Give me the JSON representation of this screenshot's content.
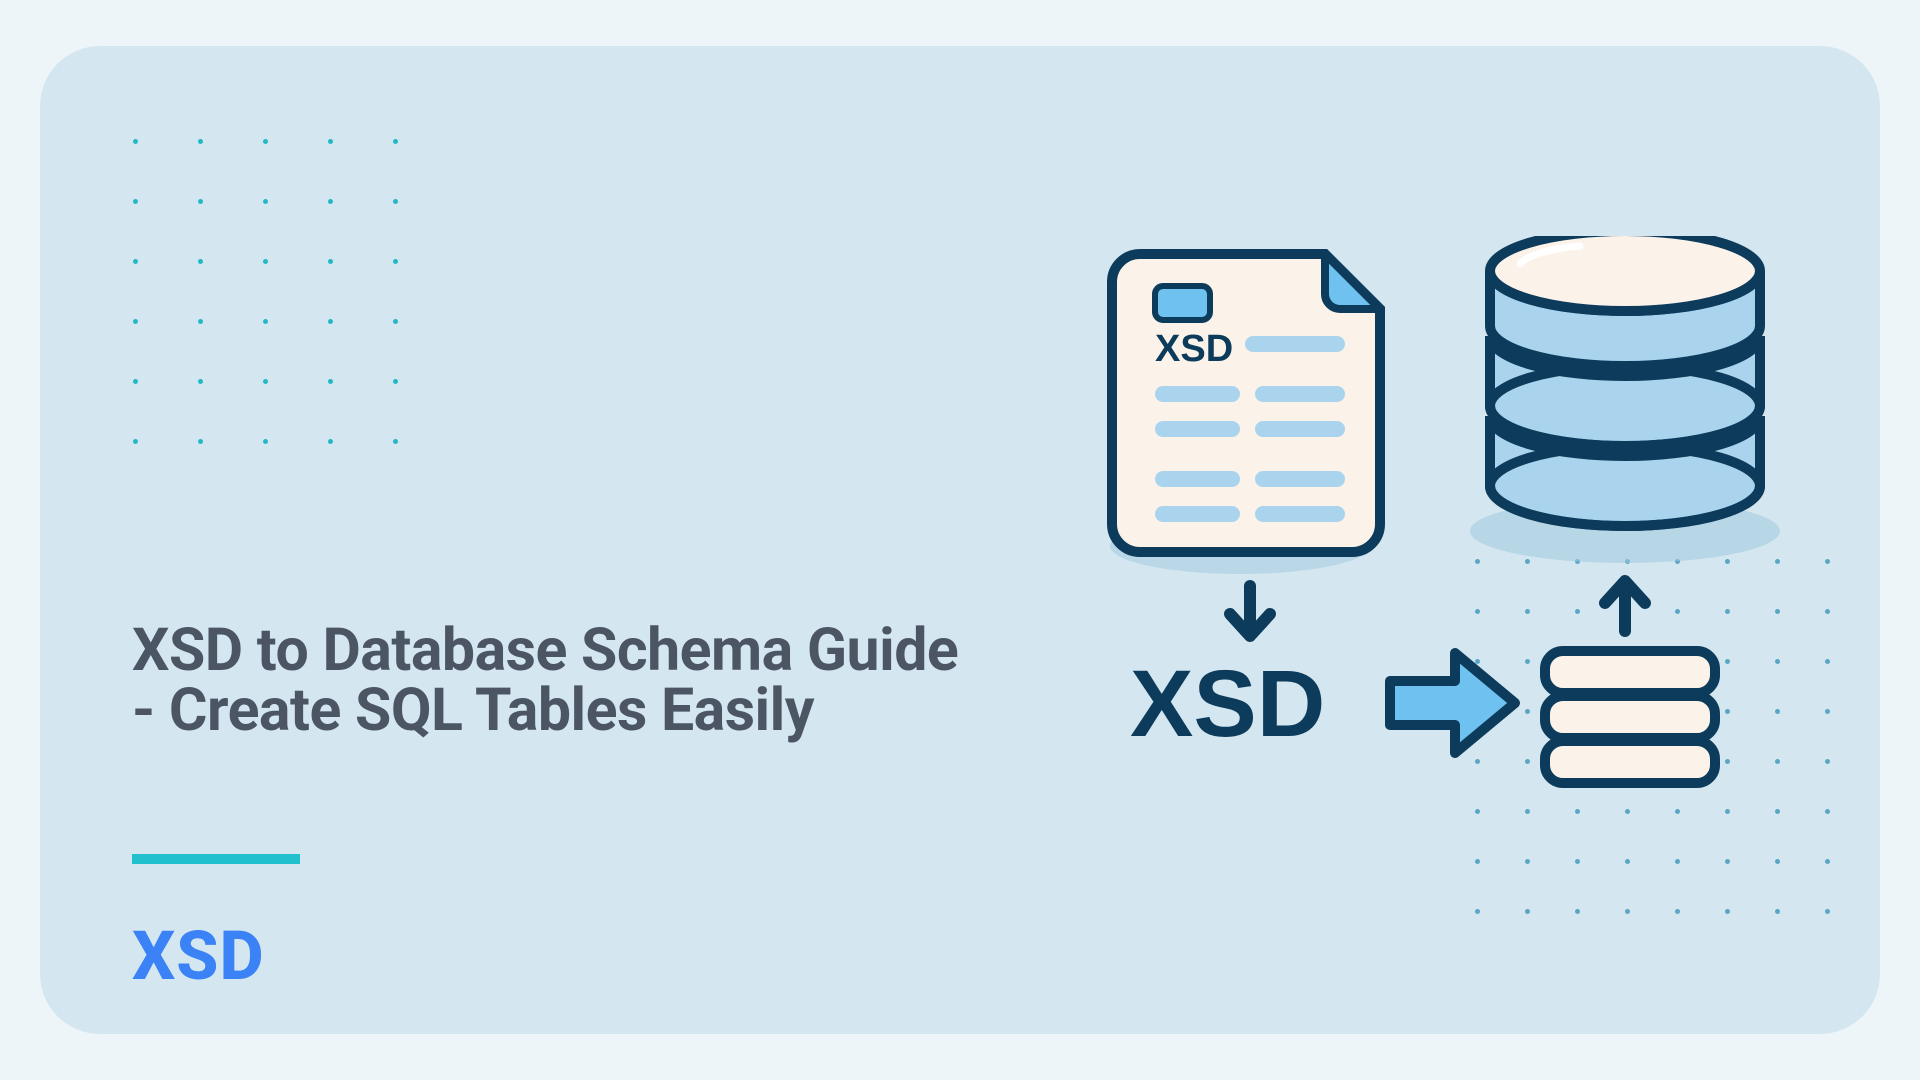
{
  "heading": "XSD to Database Schema Guide - Create SQL Tables Easily",
  "brand": "XSD",
  "illustration": {
    "doc_label": "XSD",
    "flow_label": "XSD"
  },
  "colors": {
    "page_bg": "#eef5f9",
    "card_bg": "#d4e7f0",
    "dot_teal": "#24b8c6",
    "dot_blue": "#5aa6c4",
    "heading_text": "#4b5563",
    "accent_underline": "#21c0cf",
    "brand_blue": "#3b82f6",
    "stroke_dark": "#0d3b5c",
    "fill_light": "#aad4ee",
    "fill_paper": "#fbf3e9",
    "fill_highlight": "#6fc2ef"
  }
}
